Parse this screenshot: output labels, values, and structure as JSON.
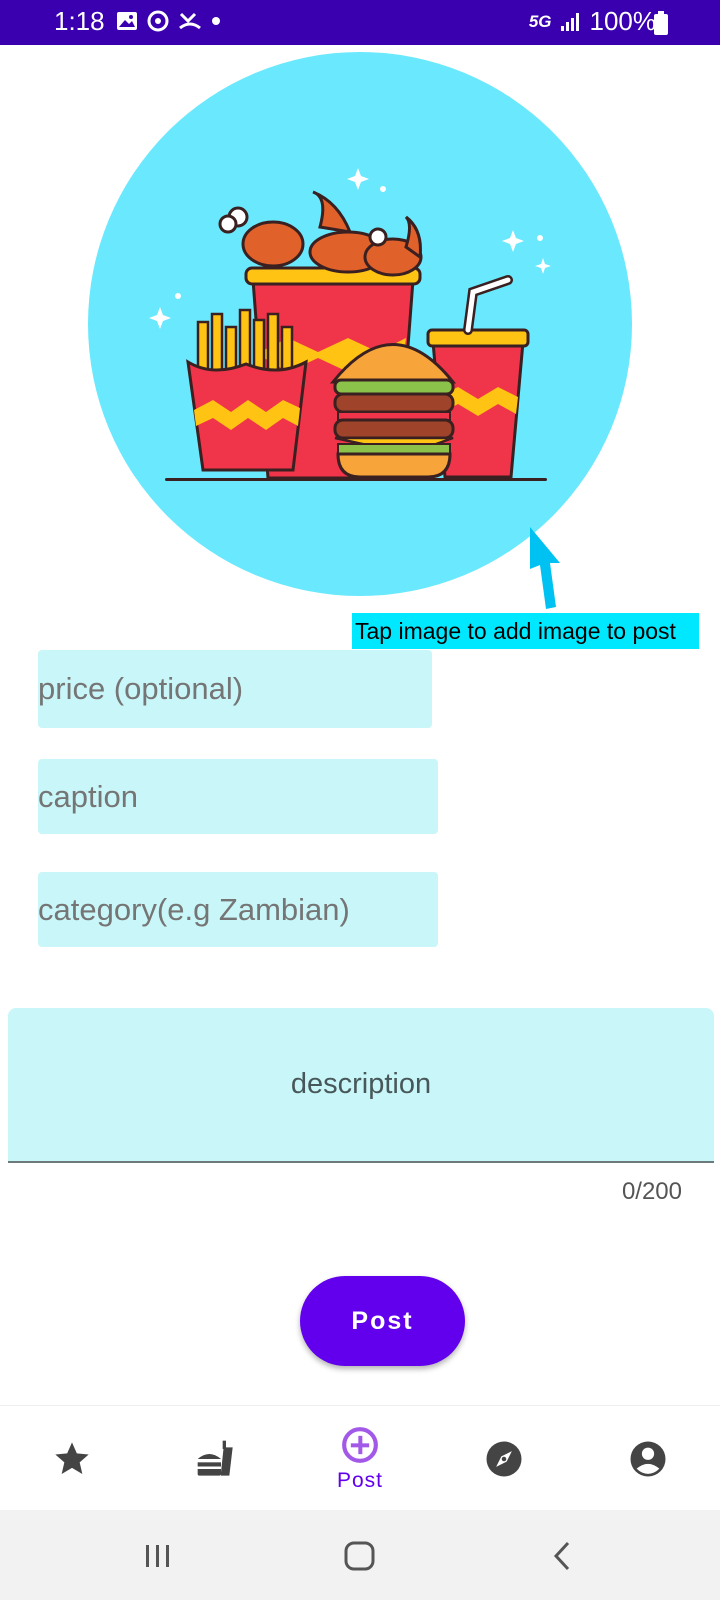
{
  "status_bar": {
    "time": "1:18",
    "network": "5G",
    "battery": "100%"
  },
  "hint": {
    "text": "Tap image to add image to post"
  },
  "form": {
    "price_placeholder": "price (optional)",
    "caption_placeholder": "caption",
    "category_placeholder": "category(e.g Zambian)",
    "description_placeholder": "description",
    "char_counter": "0/200",
    "post_button": "Post"
  },
  "bottom_nav": {
    "items": [
      {
        "icon": "star-icon"
      },
      {
        "icon": "fastfood-icon"
      },
      {
        "icon": "add-circle-icon",
        "label": "Post",
        "active": true
      },
      {
        "icon": "explore-icon"
      },
      {
        "icon": "account-icon"
      }
    ]
  },
  "colors": {
    "status_bar": "#3a00b0",
    "accent": "#6200ee",
    "field_bg": "#c9f6f8",
    "image_bg": "#6ae8fd",
    "hint_bg": "#00e8ff"
  }
}
